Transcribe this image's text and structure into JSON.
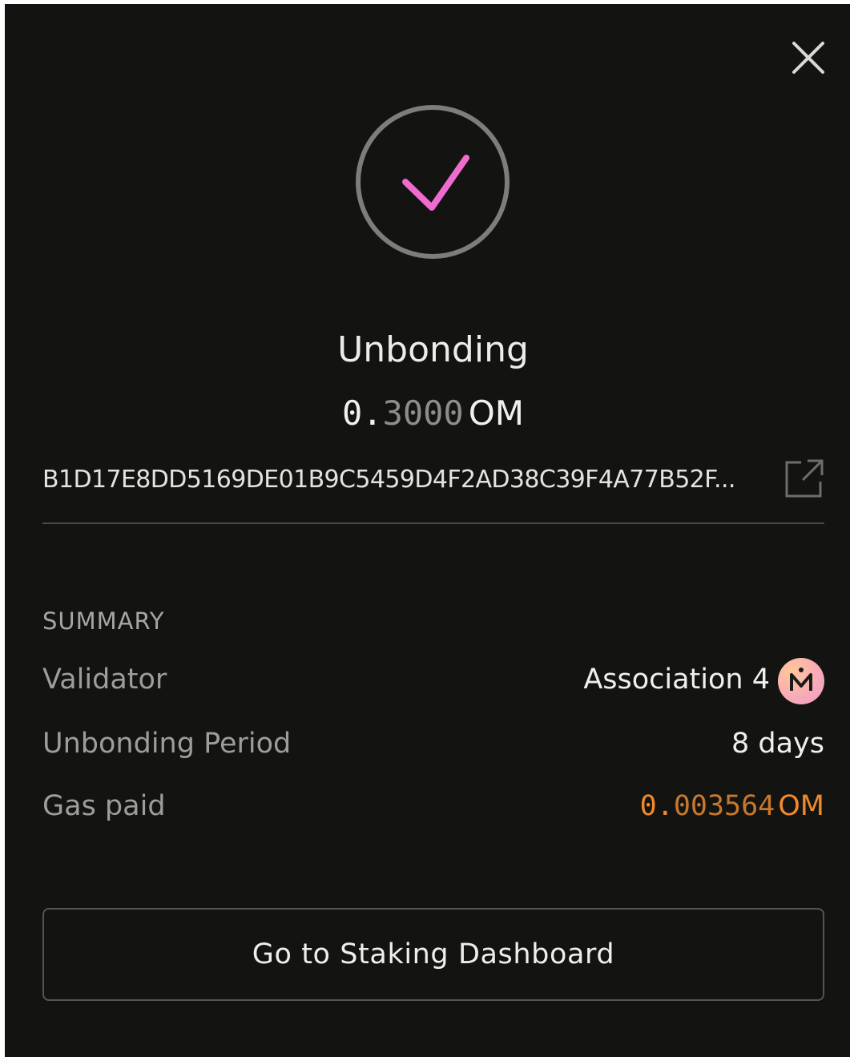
{
  "dialog": {
    "close_icon": "close-icon",
    "status_icon": "checkmark-icon",
    "title": "Unbonding",
    "amount": {
      "lead": "0.",
      "trail": "3000",
      "unit": "OM"
    },
    "transaction": {
      "hash": "B1D17E8DD5169DE01B9C5459D4F2AD38C39F4A77B52F...",
      "link_icon": "external-link-icon"
    }
  },
  "summary": {
    "heading": "SUMMARY",
    "validator": {
      "label": "Validator",
      "value": "Association 4",
      "avatar_icon": "mantra-logo-icon"
    },
    "unbonding_period": {
      "label": "Unbonding Period",
      "value": "8 days"
    },
    "gas_paid": {
      "label": "Gas paid",
      "lead": "0.",
      "trail": "003564",
      "unit": "OM"
    }
  },
  "actions": {
    "dashboard_label": "Go to Staking Dashboard"
  },
  "colors": {
    "background": "#131311",
    "checkmark": "#f06bd0",
    "gas_accent": "#f08a2b",
    "ring": "#7d7d7a"
  }
}
